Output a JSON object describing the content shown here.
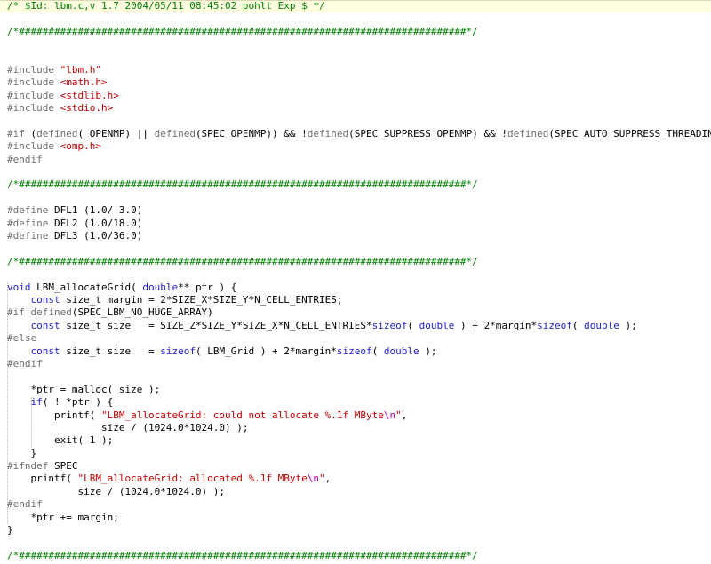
{
  "lines": [
    [
      {
        "t": "/* $Id: lbm.c,v 1.7 2004/05/11 08:45:02 pohlt Exp $ */",
        "c": "cm"
      }
    ],
    [],
    [
      {
        "t": "/*############################################################################*/",
        "c": "cm"
      }
    ],
    [],
    [],
    [
      {
        "t": "#include ",
        "c": "pp"
      },
      {
        "t": "\"lbm.h\"",
        "c": "str"
      }
    ],
    [
      {
        "t": "#include ",
        "c": "pp"
      },
      {
        "t": "<math.h>",
        "c": "str"
      }
    ],
    [
      {
        "t": "#include ",
        "c": "pp"
      },
      {
        "t": "<stdlib.h>",
        "c": "str"
      }
    ],
    [
      {
        "t": "#include ",
        "c": "pp"
      },
      {
        "t": "<stdio.h>",
        "c": "str"
      }
    ],
    [],
    [
      {
        "t": "#if ",
        "c": "pp"
      },
      {
        "t": "(",
        "c": "txt"
      },
      {
        "t": "defined",
        "c": "fn"
      },
      {
        "t": "(_OPENMP) || ",
        "c": "txt"
      },
      {
        "t": "defined",
        "c": "fn"
      },
      {
        "t": "(SPEC_OPENMP)) && !",
        "c": "txt"
      },
      {
        "t": "defined",
        "c": "fn"
      },
      {
        "t": "(SPEC_SUPPRESS_OPENMP) && !",
        "c": "txt"
      },
      {
        "t": "defined",
        "c": "fn"
      },
      {
        "t": "(SPEC_AUTO_SUPPRESS_THREADING)",
        "c": "txt"
      }
    ],
    [
      {
        "t": "#include ",
        "c": "pp"
      },
      {
        "t": "<omp.h>",
        "c": "str"
      }
    ],
    [
      {
        "t": "#endif",
        "c": "pp"
      }
    ],
    [],
    [
      {
        "t": "/*############################################################################*/",
        "c": "cm"
      }
    ],
    [],
    [
      {
        "t": "#define ",
        "c": "pp"
      },
      {
        "t": "DFL1 (1.0/ 3.0)",
        "c": "txt"
      }
    ],
    [
      {
        "t": "#define ",
        "c": "pp"
      },
      {
        "t": "DFL2 (1.0/18.0)",
        "c": "txt"
      }
    ],
    [
      {
        "t": "#define ",
        "c": "pp"
      },
      {
        "t": "DFL3 (1.0/36.0)",
        "c": "txt"
      }
    ],
    [],
    [
      {
        "t": "/*############################################################################*/",
        "c": "cm"
      }
    ],
    [],
    [
      {
        "t": "void",
        "c": "kw"
      },
      {
        "t": " LBM_allocateGrid( ",
        "c": "txt"
      },
      {
        "t": "double",
        "c": "kw"
      },
      {
        "t": "** ptr ) {",
        "c": "txt"
      }
    ],
    [
      {
        "t": "    ",
        "c": "txt"
      },
      {
        "t": "const",
        "c": "kw"
      },
      {
        "t": " size_t margin = 2*SIZE_X*SIZE_Y*N_CELL_ENTRIES;",
        "c": "txt"
      }
    ],
    [
      {
        "t": "#if ",
        "c": "pp"
      },
      {
        "t": "defined",
        "c": "fn"
      },
      {
        "t": "(SPEC_LBM_NO_HUGE_ARRAY)",
        "c": "txt"
      }
    ],
    [
      {
        "t": "    ",
        "c": "txt"
      },
      {
        "t": "const",
        "c": "kw"
      },
      {
        "t": " size_t size   = SIZE_Z*SIZE_Y*SIZE_X*N_CELL_ENTRIES*",
        "c": "txt"
      },
      {
        "t": "sizeof",
        "c": "kw"
      },
      {
        "t": "( ",
        "c": "txt"
      },
      {
        "t": "double",
        "c": "kw"
      },
      {
        "t": " ) + 2*margin*",
        "c": "txt"
      },
      {
        "t": "sizeof",
        "c": "kw"
      },
      {
        "t": "( ",
        "c": "txt"
      },
      {
        "t": "double",
        "c": "kw"
      },
      {
        "t": " );",
        "c": "txt"
      }
    ],
    [
      {
        "t": "#else",
        "c": "pp"
      }
    ],
    [
      {
        "t": "    ",
        "c": "txt"
      },
      {
        "t": "const",
        "c": "kw"
      },
      {
        "t": " size_t size   = ",
        "c": "txt"
      },
      {
        "t": "sizeof",
        "c": "kw"
      },
      {
        "t": "( LBM_Grid ) + 2*margin*",
        "c": "txt"
      },
      {
        "t": "sizeof",
        "c": "kw"
      },
      {
        "t": "( ",
        "c": "txt"
      },
      {
        "t": "double",
        "c": "kw"
      },
      {
        "t": " );",
        "c": "txt"
      }
    ],
    [
      {
        "t": "#endif",
        "c": "pp"
      }
    ],
    [],
    [
      {
        "t": "    *ptr = malloc( size );",
        "c": "txt"
      }
    ],
    [
      {
        "t": "    ",
        "c": "txt"
      },
      {
        "t": "if",
        "c": "kw"
      },
      {
        "t": "( ! *ptr ) {",
        "c": "txt"
      }
    ],
    [
      {
        "t": "        printf( ",
        "c": "txt"
      },
      {
        "t": "\"LBM_allocateGrid: could not allocate %.1f MByte",
        "c": "str"
      },
      {
        "t": "\\n",
        "c": "esc"
      },
      {
        "t": "\"",
        "c": "str"
      },
      {
        "t": ",",
        "c": "txt"
      }
    ],
    [
      {
        "t": "                size / (1024.0*1024.0) );",
        "c": "txt"
      }
    ],
    [
      {
        "t": "        exit( 1 );",
        "c": "txt"
      }
    ],
    [
      {
        "t": "    }",
        "c": "txt"
      }
    ],
    [
      {
        "t": "#ifndef ",
        "c": "pp"
      },
      {
        "t": "SPEC",
        "c": "txt"
      }
    ],
    [
      {
        "t": "    printf( ",
        "c": "txt"
      },
      {
        "t": "\"LBM_allocateGrid: allocated %.1f MByte",
        "c": "str"
      },
      {
        "t": "\\n",
        "c": "esc"
      },
      {
        "t": "\"",
        "c": "str"
      },
      {
        "t": ",",
        "c": "txt"
      }
    ],
    [
      {
        "t": "            size / (1024.0*1024.0) );",
        "c": "txt"
      }
    ],
    [
      {
        "t": "#endif",
        "c": "pp"
      }
    ],
    [
      {
        "t": "    *ptr += margin;",
        "c": "txt"
      }
    ],
    [
      {
        "t": "}",
        "c": "txt"
      }
    ],
    [],
    [
      {
        "t": "/*############################################################################*/",
        "c": "cm"
      }
    ]
  ]
}
